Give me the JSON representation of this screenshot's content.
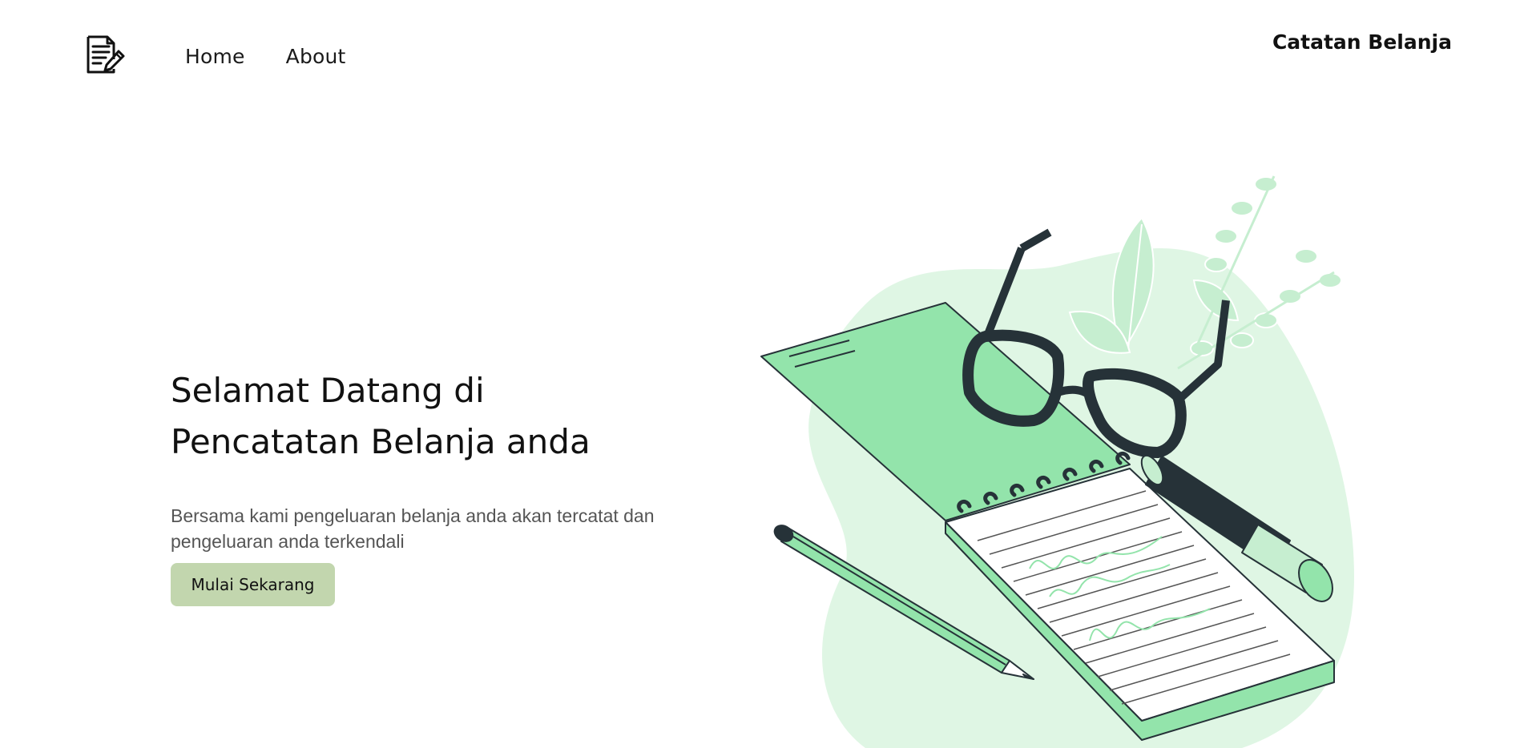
{
  "nav": {
    "logo_icon": "document-pen-icon",
    "links": [
      {
        "label": "Home"
      },
      {
        "label": "About"
      }
    ],
    "brand": "Catatan Belanja"
  },
  "hero": {
    "title_line1": "Selamat Datang di",
    "title_line2": "Pencatatan Belanja anda",
    "subtitle": "Bersama kami pengeluaran belanja anda akan tercatat dan pengeluaran anda terkendali",
    "cta_label": "Mulai Sekarang",
    "illustration": "notebook-glasses-pen-illustration"
  },
  "colors": {
    "cta_background": "#c2d6ae",
    "illustration_green": "#93e4ab",
    "illustration_light_green": "#dff6e4",
    "illustration_dark": "#263238"
  }
}
